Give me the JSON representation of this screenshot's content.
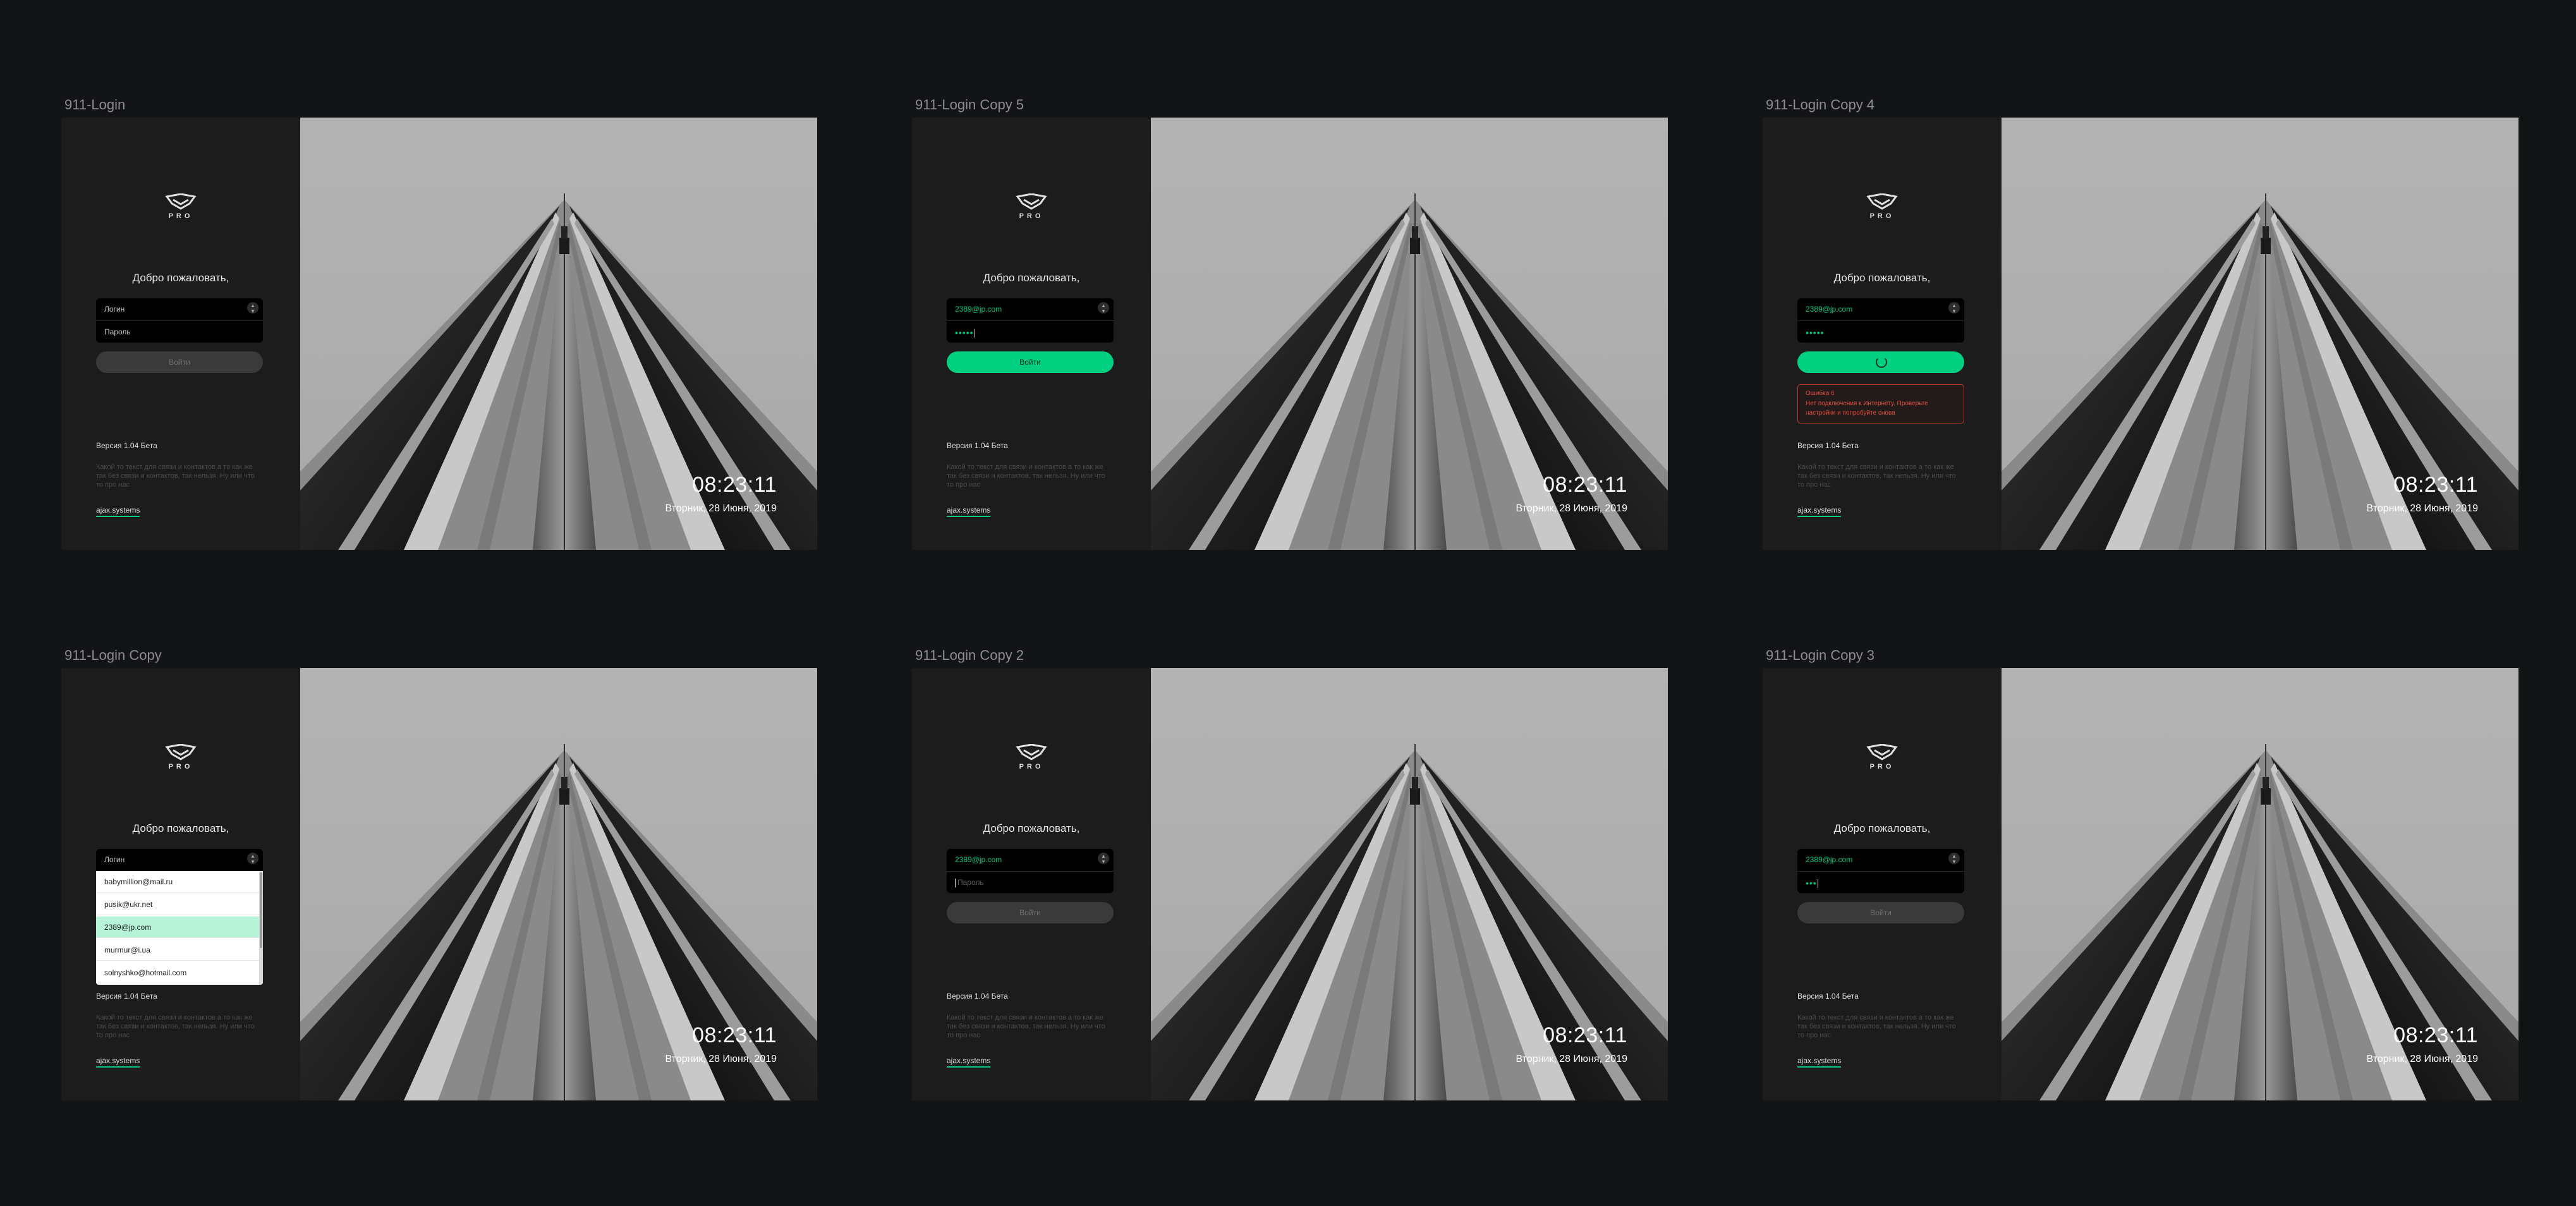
{
  "common": {
    "logo_text": "PRO",
    "welcome": "Добро пожаловать,",
    "login_placeholder": "Логин",
    "password_placeholder": "Пароль",
    "login_button": "Войти",
    "version": "Версия 1.04 Бета",
    "description": "Какой то текст для связи и контактов а то как же так без связи и контактов, так нельзя. Ну или что то про нас",
    "link": "ajax.systems",
    "clock": "08:23:11",
    "date": "Вторник, 28 Июня, 2019",
    "email_value": "2389@jp.com",
    "password_dots_full": "•••••",
    "password_dots_short": "•••"
  },
  "frames": {
    "f1": {
      "title": "911-Login"
    },
    "f2": {
      "title": "911-Login Copy 5"
    },
    "f3": {
      "title": "911-Login Copy 4",
      "error_title": "Ошибка 6",
      "error_message": "Нет подключения к Интернету. Проверьте настройки и попробуйте снова"
    },
    "f4": {
      "title": "911-Login Copy",
      "dropdown": [
        "babymillion@mail.ru",
        "pusik@ukr.net",
        "2389@jp.com",
        "murmur@i.ua",
        "solnyshko@hotmail.com"
      ]
    },
    "f5": {
      "title": "911-Login Copy 2"
    },
    "f6": {
      "title": "911-Login Copy 3"
    }
  },
  "colors": {
    "accent": "#00d07f",
    "background": "#131416",
    "panel": "#1c1c1d",
    "error": "#e25040"
  }
}
